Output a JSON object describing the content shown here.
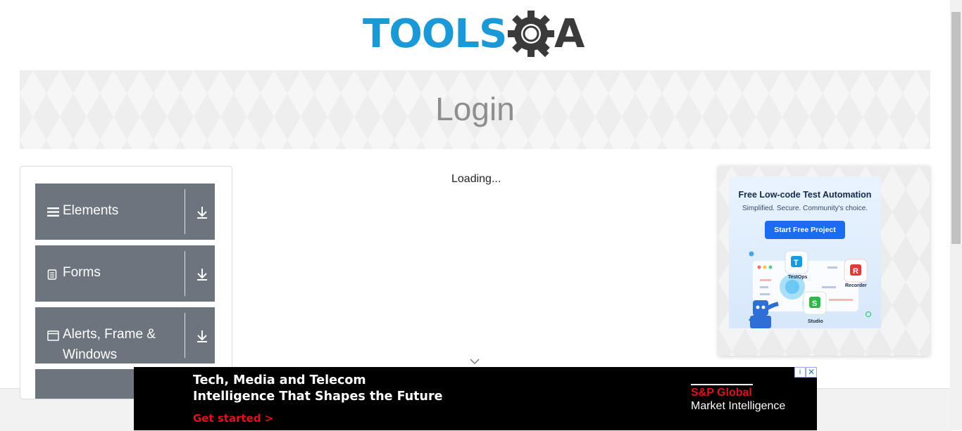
{
  "header": {
    "logo_text_left": "TOOLS",
    "logo_text_right": "A",
    "logo_colors": {
      "blue": "#1b98d6",
      "dark": "#3a3a3a"
    },
    "logo_icon": "gear-magnifier-icon"
  },
  "banner": {
    "title": "Login"
  },
  "sidebar": {
    "groups": [
      {
        "label": "Elements",
        "icon": "hamburger-icon",
        "toggle_icon": "download-arrow-icon"
      },
      {
        "label": "Forms",
        "icon": "document-icon",
        "toggle_icon": "download-arrow-icon"
      },
      {
        "label_line1": "Alerts, Frame &",
        "label_line2": "Windows",
        "icon": "window-icon",
        "toggle_icon": "download-arrow-icon"
      }
    ],
    "group_bg": "#6c757d"
  },
  "main": {
    "status_text": "Loading..."
  },
  "side_ad": {
    "title": "Free Low-code Test Automation",
    "subtitle": "Simplified. Secure. Community's choice.",
    "button_label": "Start Free Project",
    "labels": [
      "TestOps",
      "Recorder",
      "Studio"
    ],
    "accent": "#1a6cf0"
  },
  "bottom_ad": {
    "line1": "Tech, Media and Telecom",
    "line2": "Intelligence That Shapes the Future",
    "cta": "Get started >",
    "brand_line1": "S&P Global",
    "brand_line2": "Market Intelligence",
    "cta_color": "#e0111d",
    "adchoices_glyph": "i",
    "close_glyph": "✕"
  }
}
